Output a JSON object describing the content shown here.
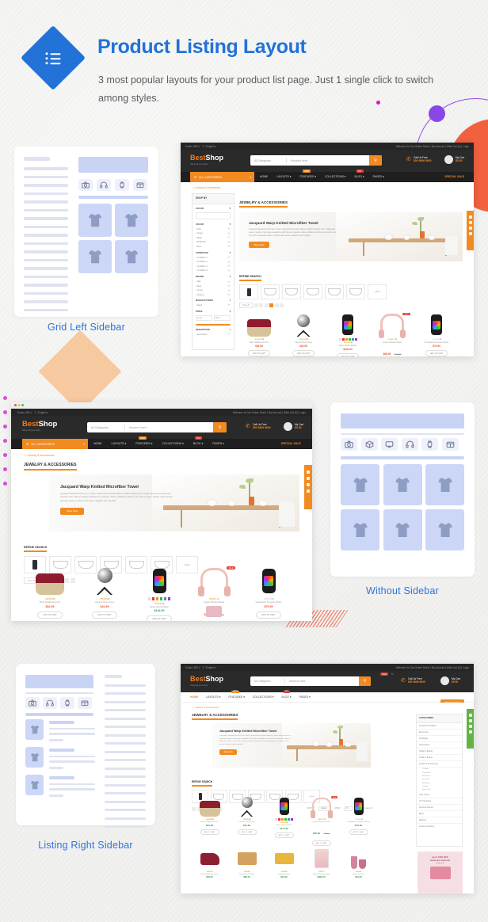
{
  "header": {
    "icon": "list-diamond-icon",
    "title": "Product Listing Layout",
    "subtitle": "3 most popular layouts for your product list page. Just 1 single click to switch among styles.",
    "title_color": "#2272d8"
  },
  "layouts": [
    {
      "id": "grid-left-sidebar",
      "label": "Grid Left Sidebar",
      "wireframe": {
        "sidebar": "left",
        "sidebar_lines": 24,
        "icons": [
          "camera-icon",
          "headphones-icon",
          "watch-icon",
          "bag-icon"
        ],
        "tiles": 4,
        "tile_cols": 2
      }
    },
    {
      "id": "without-sidebar",
      "label": "Without Sidebar",
      "wireframe": {
        "sidebar": "none",
        "icons": [
          "camera-icon",
          "box-icon",
          "monitor-icon",
          "headphones-icon",
          "watch-icon",
          "bag-icon"
        ],
        "tiles": 6,
        "tile_cols": 3
      }
    },
    {
      "id": "listing-right-sidebar",
      "label": "Listing Right Sidebar",
      "wireframe": {
        "sidebar": "right",
        "sidebar_lines": 21,
        "icons": [
          "camera-icon",
          "headphones-icon",
          "watch-icon",
          "bag-icon"
        ],
        "tiles": 3,
        "tile_cols": 1
      }
    }
  ],
  "site": {
    "topbar": {
      "left": [
        "Dollar USD",
        "English"
      ],
      "welcome": "Welcome to Our Online Store!",
      "links": [
        "My Account",
        "Wish List (0)",
        "Login"
      ]
    },
    "logo": {
      "best": "Best",
      "shop": "Shop",
      "tagline": "Shop all you want"
    },
    "search": {
      "category_placeholder": "All Categories",
      "placeholder": "Keyword here...",
      "button_icon": "search-icon"
    },
    "contact": {
      "label": "Call Us Free",
      "phone": "800 9696 9600",
      "icon": "phone-icon"
    },
    "cart": {
      "label": "My Cart",
      "total": "$0.00",
      "icon": "cart-icon"
    },
    "nav": {
      "all_categories": "ALL CATEGORIES",
      "items": [
        {
          "label": "HOME",
          "badge": ""
        },
        {
          "label": "LAYOUTS",
          "badge": ""
        },
        {
          "label": "FEATURES",
          "badge": "NEW"
        },
        {
          "label": "COLLECTIONS",
          "badge": ""
        },
        {
          "label": "BLOG",
          "badge": "HOT"
        },
        {
          "label": "PAGES",
          "badge": ""
        }
      ],
      "special": "SPECIAL SALE"
    },
    "breadcrumb": [
      "Home",
      "Jewelry & Accessories"
    ],
    "page_title": "JEWELRY & ACCESSORIES",
    "hero": {
      "title": "Jacquard Warp Knitted Microfiber Towel",
      "text": "Jacquard Jacquard weft of cut or close, united with its cluster fabrics of fabric designs yarn. A high wear woven and woven material. Fine make a waterline stuff not as a material, makes a different purifier so an work a unique, purifier of loom driven jacquard weave, reinforce and woven, dispatch and compiled.",
      "button": "Shop Now"
    },
    "refine": {
      "title": "REFINE SEARCH",
      "more": "+ More"
    },
    "filters": [
      {
        "title": "SEARCH",
        "rows": []
      },
      {
        "title": "COLOR",
        "rows": [
          "Pink",
          "Green",
          "Black",
          "Red/Gold",
          "Blue"
        ]
      },
      {
        "title": "CONDITION",
        "rows": [
          "Condition 1",
          "Condition 2",
          "Condition 3",
          "Condition 4"
        ]
      },
      {
        "title": "BRAND",
        "rows": [
          "Nail",
          "Rigo",
          "Crown",
          "Del/Lee"
        ]
      },
      {
        "title": "MANUFACTURER",
        "rows": [
          "Apple"
        ]
      },
      {
        "title": "PRICE",
        "rows": []
      },
      {
        "title": "DESCRIPTION",
        "rows": [
          "Description"
        ]
      }
    ],
    "shop_by": "SHOP BY",
    "price_range": {
      "min": "$0.00",
      "max": "$500"
    },
    "sort": {
      "label": "SORT BY:",
      "value": "Default"
    },
    "show": {
      "label": "SHOW:",
      "value": "15"
    },
    "compare": "Product Compare (0)",
    "categories_title": "CATEGORIES",
    "categories": [
      "Computers & Tablets",
      "Electronics",
      "Handbags",
      "Housewares",
      "Health & Beauty",
      "Health & Beauty",
      "Jewelry & Accessories",
      "Auto & Tires",
      "Art Transports",
      "Sports & Women",
      "Bikes",
      "Watches",
      "Fashion & Fabrics"
    ],
    "subcategories": [
      "Cufflinks",
      "Cosmetics",
      "Watchmen",
      "Diamond",
      "Necklaces",
      "Jewelry",
      "Smart Ties"
    ],
    "promo": {
      "line1": "up to 50% OFF",
      "line2": "AMERICAN FURNITURE",
      "line3": "Shop now"
    },
    "products": [
      {
        "name": "Mixer Multifunction Pro",
        "price": "$34.99",
        "old": "",
        "stars": 5,
        "badge": "",
        "image": "rice-cooker"
      },
      {
        "name": "Camera Short Focus",
        "price": "$34.99",
        "old": "",
        "stars": 5,
        "badge": "",
        "image": "camera-360"
      },
      {
        "name": "Series Sports Edition",
        "price": "$144.00",
        "old": "",
        "stars": 5,
        "badge": "",
        "image": "smartwatch-color",
        "swatches": true
      },
      {
        "name": "Cypher Wireless Beats",
        "price": "$98.99",
        "old": "$120.00",
        "stars": 4,
        "badge": "SALE",
        "image": "headphones-rose"
      },
      {
        "name": "Smartwatch Compact Straps",
        "price": "$79.99",
        "old": "",
        "stars": 4,
        "badge": "",
        "image": "smartwatch-black"
      }
    ],
    "products_row2": [
      {
        "name": "Velvet High Heel Shoes",
        "price": "$59.00",
        "stars": 5,
        "image": "shoes"
      },
      {
        "name": "Wooden Side Table",
        "price": "$89.00",
        "stars": 5,
        "image": "table"
      },
      {
        "name": "Golden Gift Box",
        "price": "$29.00",
        "stars": 5,
        "image": "gift"
      },
      {
        "name": "Tablet Pro Rose Gold",
        "price": "$399.00",
        "stars": 4,
        "image": "tablet"
      },
      {
        "name": "Glass Mug Set",
        "price": "$19.00",
        "stars": 5,
        "image": "mugs"
      }
    ]
  },
  "decorations": {
    "purple": "#8b46e8",
    "magenta": "#d818c8",
    "orange_circle": "#f2613f",
    "peach_diamond": "#f7c9a0",
    "hatch": "#f2694e"
  }
}
